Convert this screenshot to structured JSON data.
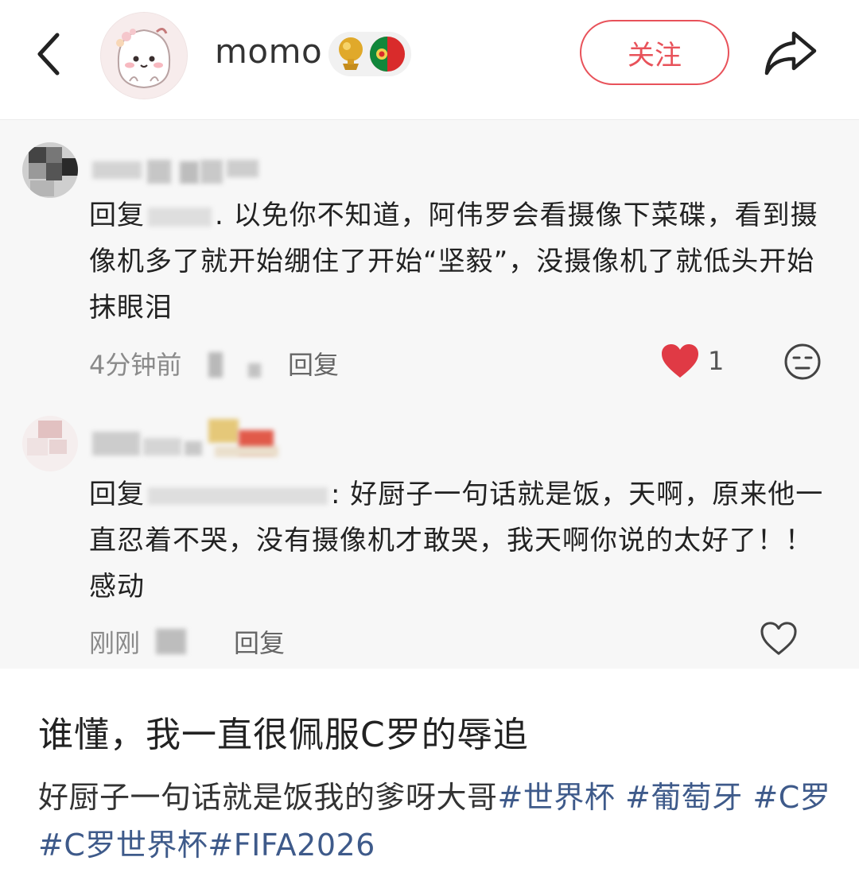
{
  "header": {
    "username": "momo",
    "follow_label": "关注",
    "badge_icon": "golden-ball-portugal-flag-badge"
  },
  "comments": [
    {
      "reply_prefix": "回复",
      "reply_to": "",
      "separator": ".",
      "text": "以免你不知道，阿伟罗会看摄像下菜碟，看到摄像机多了就开始绷住了开始“坚毅”，没摄像机了就低头开始抹眼泪",
      "time": "4分钟前",
      "reply_label": "回复",
      "likes": "1",
      "liked": true
    },
    {
      "reply_prefix": "回复",
      "reply_to": "",
      "separator": ":",
      "text": "好厨子一句话就是饭，天啊，原来他一直忍着不哭，没有摄像机才敢哭，我天啊你说的太好了！！ 感动",
      "time": "刚刚",
      "reply_label": "回复",
      "liked": false
    }
  ],
  "post": {
    "title": "谁懂，我一直很佩服C罗的辱追",
    "body_text": "好厨子一句话就是饭我的爹呀大哥",
    "tags": [
      "#世界杯",
      "#葡萄牙",
      "#C罗",
      "#C罗世界杯",
      "#FIFA2026"
    ]
  },
  "colors": {
    "accent": "#e8525a",
    "tag": "#3e5a8a",
    "heart": "#e03a45"
  }
}
